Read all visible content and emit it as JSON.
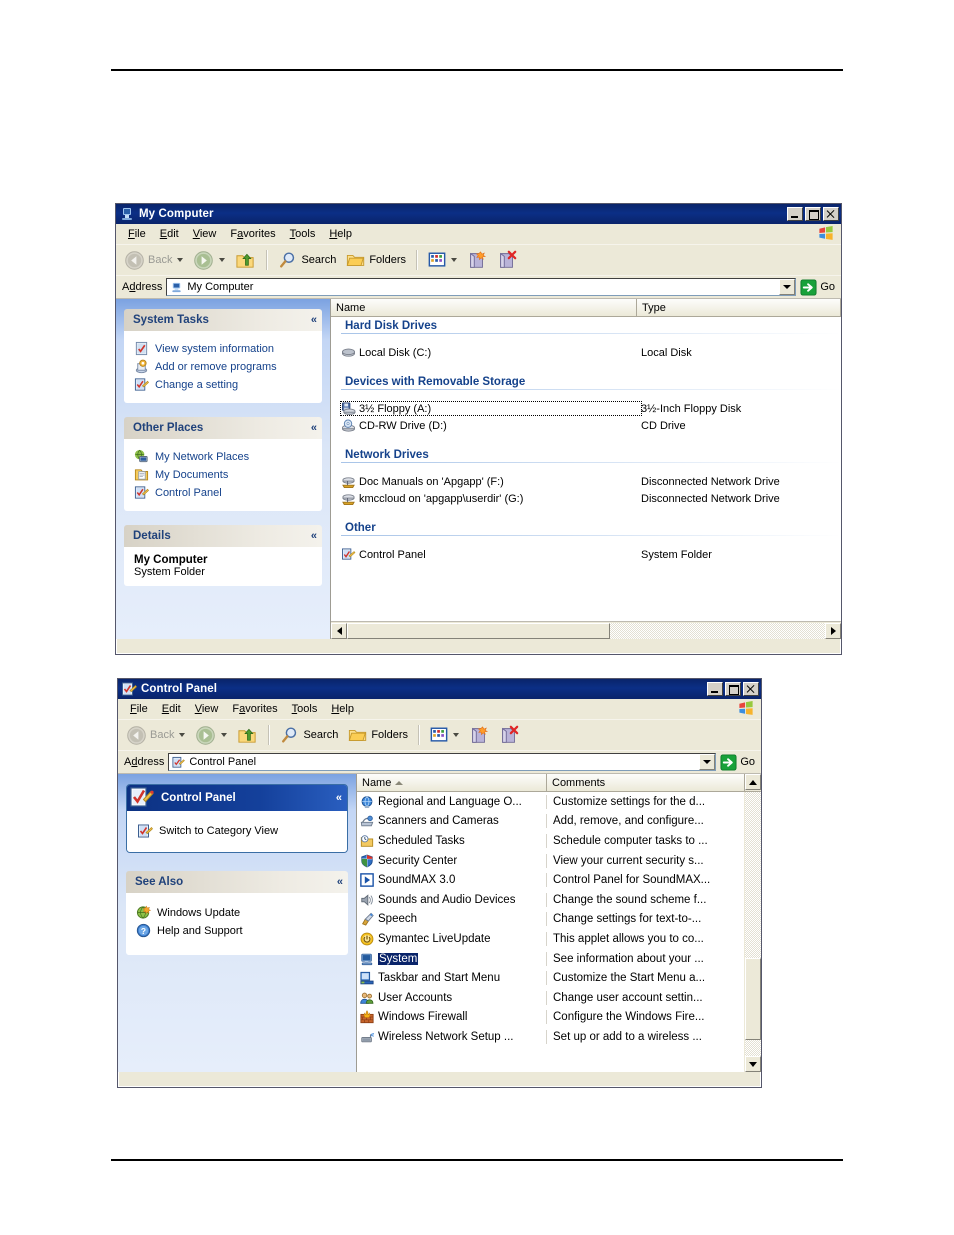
{
  "document": {
    "rules": {
      "top": "horizontal-rule",
      "bottom": "horizontal-rule"
    }
  },
  "window_my_computer": {
    "title": "My Computer",
    "title_icon": "my-computer-icon",
    "controls": {
      "minimize": "_",
      "maximize": "□",
      "close": "×"
    },
    "menu": [
      {
        "label": "File",
        "accel": "F"
      },
      {
        "label": "Edit",
        "accel": "E"
      },
      {
        "label": "View",
        "accel": "V"
      },
      {
        "label": "Favorites",
        "accel": "a"
      },
      {
        "label": "Tools",
        "accel": "T"
      },
      {
        "label": "Help",
        "accel": "H"
      }
    ],
    "toolbar": {
      "back": "Back",
      "forward": "",
      "up": "",
      "search": "Search",
      "folders": "Folders",
      "views": "",
      "move_to": "",
      "delete": ""
    },
    "address": {
      "label": "Address",
      "value": "My Computer",
      "go": "Go"
    },
    "sidebar": {
      "panels": [
        {
          "title": "System Tasks",
          "collapse": "«",
          "items": [
            {
              "label": "View system information",
              "icon": "system-information-icon"
            },
            {
              "label": "Add or remove programs",
              "icon": "add-remove-programs-icon"
            },
            {
              "label": "Change a setting",
              "icon": "change-a-setting-icon"
            }
          ]
        },
        {
          "title": "Other Places",
          "collapse": "«",
          "items": [
            {
              "label": "My Network Places",
              "icon": "network-places-icon"
            },
            {
              "label": "My Documents",
              "icon": "my-documents-icon"
            },
            {
              "label": "Control Panel",
              "icon": "control-panel-icon"
            }
          ]
        },
        {
          "title": "Details",
          "collapse": "«",
          "detail_title": "My Computer",
          "detail_subtitle": "System Folder"
        }
      ]
    },
    "list": {
      "columns": [
        "Name",
        "Type"
      ],
      "groups": [
        {
          "name": "Hard Disk Drives",
          "rows": [
            {
              "name": "Local Disk (C:)",
              "type": "Local Disk",
              "icon": "hard-disk-icon",
              "focused": false
            }
          ]
        },
        {
          "name": "Devices with Removable Storage",
          "rows": [
            {
              "name": "3½ Floppy (A:)",
              "type": "3½-Inch Floppy Disk",
              "icon": "floppy-drive-icon",
              "focused": true
            },
            {
              "name": "CD-RW Drive (D:)",
              "type": "CD Drive",
              "icon": "cd-drive-icon",
              "focused": false
            }
          ]
        },
        {
          "name": "Network Drives",
          "rows": [
            {
              "name": "Doc Manuals on 'Apgapp' (F:)",
              "type": "Disconnected Network Drive",
              "icon": "network-drive-icon",
              "focused": false
            },
            {
              "name": "kmccloud on 'apgapp\\userdir' (G:)",
              "type": "Disconnected Network Drive",
              "icon": "network-drive-icon",
              "focused": false
            }
          ]
        },
        {
          "name": "Other",
          "rows": [
            {
              "name": "Control Panel",
              "type": "System Folder",
              "icon": "control-panel-icon",
              "focused": false
            }
          ]
        }
      ]
    },
    "scroll": {
      "h_thumb_percent": 55
    }
  },
  "window_control_panel": {
    "title": "Control Panel",
    "title_icon": "control-panel-icon",
    "controls": {
      "minimize": "_",
      "maximize": "□",
      "close": "×"
    },
    "menu": [
      {
        "label": "File",
        "accel": "F"
      },
      {
        "label": "Edit",
        "accel": "E"
      },
      {
        "label": "View",
        "accel": "V"
      },
      {
        "label": "Favorites",
        "accel": "a"
      },
      {
        "label": "Tools",
        "accel": "T"
      },
      {
        "label": "Help",
        "accel": "H"
      }
    ],
    "toolbar": {
      "back": "Back",
      "search": "Search",
      "folders": "Folders"
    },
    "address": {
      "label": "Address",
      "value": "Control Panel",
      "go": "Go"
    },
    "sidebar": {
      "panels": [
        {
          "title": "Control Panel",
          "collapse": "«",
          "header_icon": "control-panel-icon",
          "items": [
            {
              "label": "Switch to Category View",
              "icon": "category-view-icon"
            }
          ]
        },
        {
          "title": "See Also",
          "collapse": "«",
          "items": [
            {
              "label": "Windows Update",
              "icon": "windows-update-icon"
            },
            {
              "label": "Help and Support",
              "icon": "help-and-support-icon"
            }
          ]
        }
      ]
    },
    "list": {
      "columns": [
        "Name",
        "Comments"
      ],
      "sort_column": "Name",
      "sort_direction": "ascending",
      "rows": [
        {
          "name": "Regional and Language O...",
          "comment": "Customize settings for the d...",
          "icon": "regional-options-icon",
          "selected": false
        },
        {
          "name": "Scanners and Cameras",
          "comment": "Add, remove, and configure...",
          "icon": "scanners-cameras-icon",
          "selected": false
        },
        {
          "name": "Scheduled Tasks",
          "comment": "Schedule computer tasks to ...",
          "icon": "scheduled-tasks-icon",
          "selected": false
        },
        {
          "name": "Security Center",
          "comment": "View your current security s...",
          "icon": "security-center-icon",
          "selected": false
        },
        {
          "name": "SoundMAX 3.0",
          "comment": "Control Panel for SoundMAX...",
          "icon": "soundmax-icon",
          "selected": false
        },
        {
          "name": "Sounds and Audio Devices",
          "comment": "Change the sound scheme f...",
          "icon": "sounds-audio-icon",
          "selected": false
        },
        {
          "name": "Speech",
          "comment": "Change settings for text-to-...",
          "icon": "speech-icon",
          "selected": false
        },
        {
          "name": "Symantec LiveUpdate",
          "comment": "This applet allows you to co...",
          "icon": "symantec-liveupdate-icon",
          "selected": false
        },
        {
          "name": "System",
          "comment": "See information about your ...",
          "icon": "system-icon",
          "selected": true
        },
        {
          "name": "Taskbar and Start Menu",
          "comment": "Customize the Start Menu a...",
          "icon": "taskbar-start-menu-icon",
          "selected": false
        },
        {
          "name": "User Accounts",
          "comment": "Change user account settin...",
          "icon": "user-accounts-icon",
          "selected": false
        },
        {
          "name": "Windows Firewall",
          "comment": "Configure the Windows Fire...",
          "icon": "windows-firewall-icon",
          "selected": false
        },
        {
          "name": "Wireless Network Setup ...",
          "comment": "Set up or add to a wireless ...",
          "icon": "wireless-network-icon",
          "selected": false
        }
      ]
    },
    "scroll": {
      "v_thumb_top_percent": 63,
      "v_thumb_height_percent": 31
    }
  },
  "colors": {
    "titlebar": "#0a246a",
    "window_face": "#ece9d8",
    "selection": "#0a246a",
    "link_text": "#15428b",
    "panel_header_text": "#20427b"
  }
}
